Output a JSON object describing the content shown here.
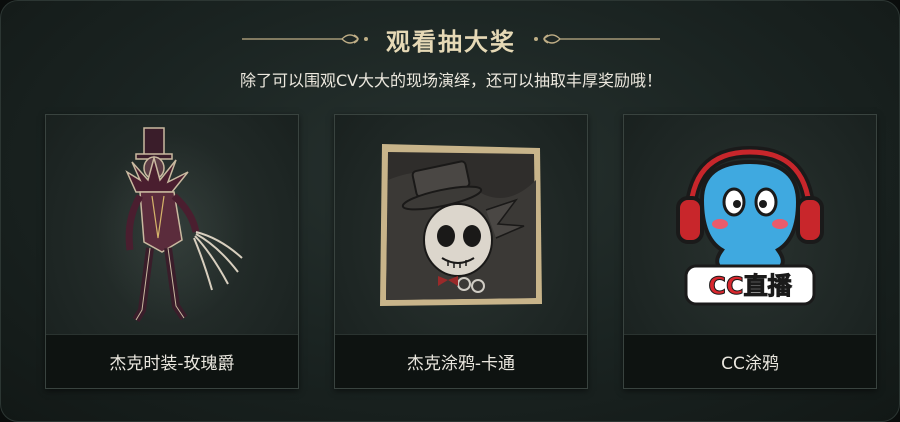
{
  "header": {
    "title": "观看抽大奖",
    "subtitle": "除了可以围观CV大大的现场演绎，还可以抽取丰厚奖励哦！"
  },
  "prizes": [
    {
      "label": "杰克时装-玫瑰爵",
      "icon": "jack-costume-figure"
    },
    {
      "label": "杰克涂鸦-卡通",
      "icon": "jack-graffiti-cartoon"
    },
    {
      "label": "CC涂鸦",
      "icon": "cc-live-mascot"
    }
  ],
  "cc_logo_text": "CC直播",
  "colors": {
    "title": "#e6d9b6",
    "panel": "#1a2321",
    "label_bar": "#0e1311",
    "mascot_blue": "#3fa9e0",
    "headphone_red": "#c8262b"
  }
}
